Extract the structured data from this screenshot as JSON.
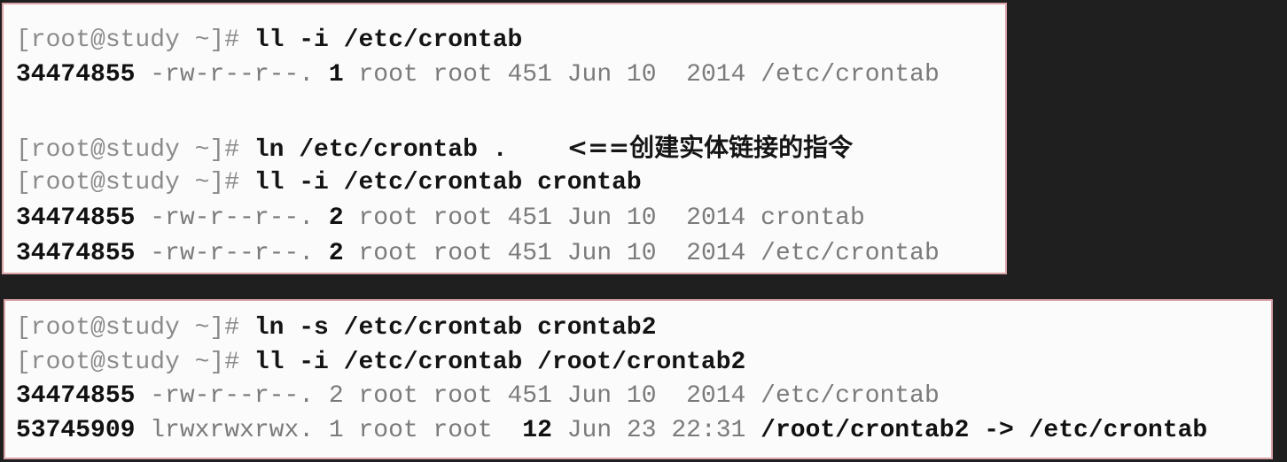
{
  "panel_top": {
    "line1": {
      "prompt": "[root@study ~]# ",
      "command": "ll -i /etc/crontab"
    },
    "line2": {
      "inode": "34474855",
      "perm": " -rw-r--r--. ",
      "count": "1",
      "meta": " root root 451 Jun 10  2014 ",
      "name": "/etc/crontab"
    },
    "line3": {
      "prompt": "[root@study ~]# ",
      "command": "ln /etc/crontab .",
      "note": "<==创建实体链接的指令"
    },
    "line4": {
      "prompt": "[root@study ~]# ",
      "command": "ll -i /etc/crontab crontab"
    },
    "line5": {
      "inode": "34474855",
      "perm": " -rw-r--r--. ",
      "count": "2",
      "meta": " root root 451 Jun 10  2014 ",
      "name": "crontab"
    },
    "line6": {
      "inode": "34474855",
      "perm": " -rw-r--r--. ",
      "count": "2",
      "meta": " root root 451 Jun 10  2014 ",
      "name": "/etc/crontab"
    }
  },
  "panel_bottom": {
    "line1": {
      "prompt": "[root@study ~]# ",
      "command": "ln -s /etc/crontab crontab2"
    },
    "line2": {
      "prompt": "[root@study ~]# ",
      "command": "ll -i /etc/crontab /root/crontab2"
    },
    "line3": {
      "inode": "34474855",
      "rest": " -rw-r--r--. 2 root root 451 Jun 10  2014 /etc/crontab"
    },
    "line4": {
      "inode": "53745909",
      "perm": " lrwxrwxrwx. 1 root root  ",
      "size": "12",
      "date": " Jun 23 22:31 ",
      "link": "/root/crontab2 -> /etc/crontab"
    }
  }
}
